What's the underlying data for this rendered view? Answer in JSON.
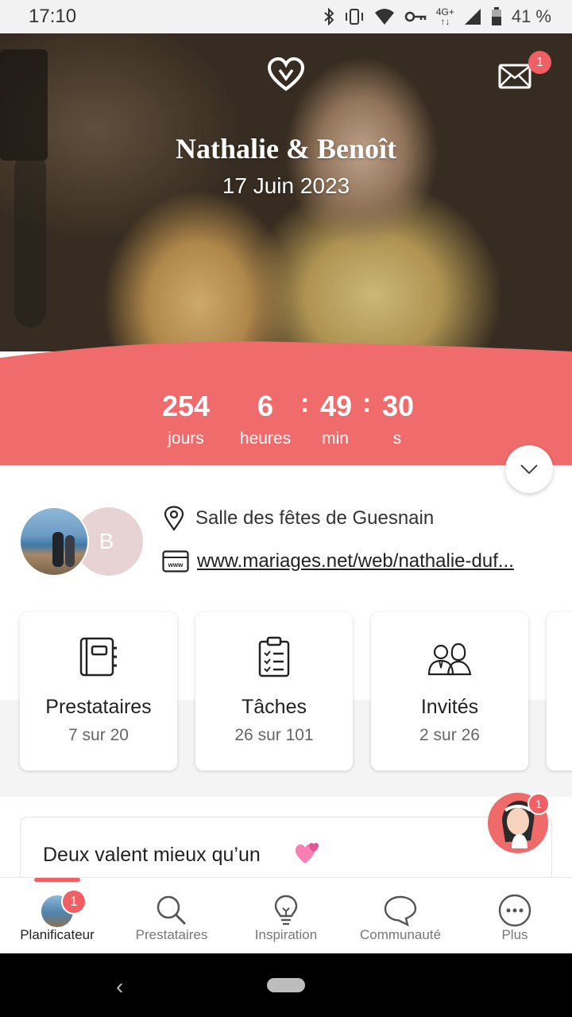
{
  "status_bar": {
    "time": "17:10",
    "network": "4G+",
    "battery_percent": "41 %",
    "icons": [
      "bluetooth-icon",
      "vibrate-icon",
      "wifi-icon",
      "vpn-key-icon",
      "signal-icon",
      "battery-icon"
    ]
  },
  "header": {
    "couple_names": "Nathalie & Benoît",
    "wedding_date": "17 Juin 2023",
    "messages_badge": "1"
  },
  "countdown": {
    "days": "254",
    "days_label": "jours",
    "hours": "6",
    "hours_label": "heures",
    "minutes": "49",
    "minutes_label": "min",
    "seconds": "30",
    "seconds_label": "s",
    "separator": ":"
  },
  "profile": {
    "partner_initial": "B",
    "venue": "Salle des fêtes de Guesnain",
    "website": "www.mariages.net/web/nathalie-duf..."
  },
  "cards": [
    {
      "title": "Prestataires",
      "count": "7 sur 20",
      "icon": "vendors-notebook-icon"
    },
    {
      "title": "Tâches",
      "count": "26 sur 101",
      "icon": "checklist-icon"
    },
    {
      "title": "Invités",
      "count": "2 sur 26",
      "icon": "guests-icon"
    }
  ],
  "tip": {
    "title": "Deux valent mieux qu’un",
    "assistant_badge": "1"
  },
  "bottom_nav": {
    "items": [
      {
        "label": "Planificateur",
        "badge": "1",
        "active": true
      },
      {
        "label": "Prestataires"
      },
      {
        "label": "Inspiration"
      },
      {
        "label": "Communauté"
      },
      {
        "label": "Plus"
      }
    ]
  },
  "colors": {
    "accent": "#ef5f63",
    "countdown_bg": "#f06b6c",
    "text_primary": "#222222",
    "text_secondary": "#666666"
  }
}
